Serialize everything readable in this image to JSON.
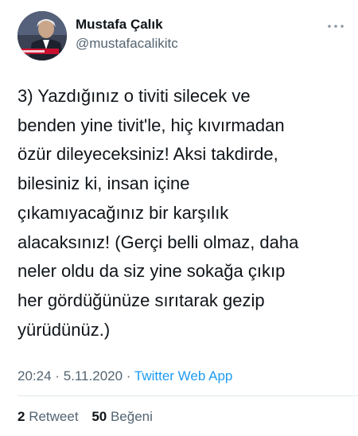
{
  "user": {
    "display_name": "Mustafa Çalık",
    "handle": "@mustafacalikitc",
    "avatar_icon": "profile-photo"
  },
  "more_icon": "ellipsis-icon",
  "tweet": {
    "lines": [
      "3) Yazdığınız o tiviti silecek ve",
      "benden yine tivit'le, hiç kıvırmadan",
      "özür dileyeceksiniz! Aksi takdirde,",
      "bilesiniz ki, insan içine",
      "çıkamıyacağınız bir karşılık",
      "alacaksınız! (Gerçi belli olmaz, daha",
      "neler oldu da siz yine sokağa çıkıp",
      "her gördüğünüze sırıtarak gezip",
      "yürüdünüz.)"
    ]
  },
  "meta": {
    "time": "20:24",
    "separator": "·",
    "date": "5.11.2020",
    "source": "Twitter Web App"
  },
  "stats": {
    "retweets_count": "2",
    "retweets_label": "Retweet",
    "likes_count": "50",
    "likes_label": "Beğeni"
  },
  "colors": {
    "text": "#0f1419",
    "secondary": "#536471",
    "link": "#1d9bf0",
    "divider": "#e1e8ed"
  }
}
